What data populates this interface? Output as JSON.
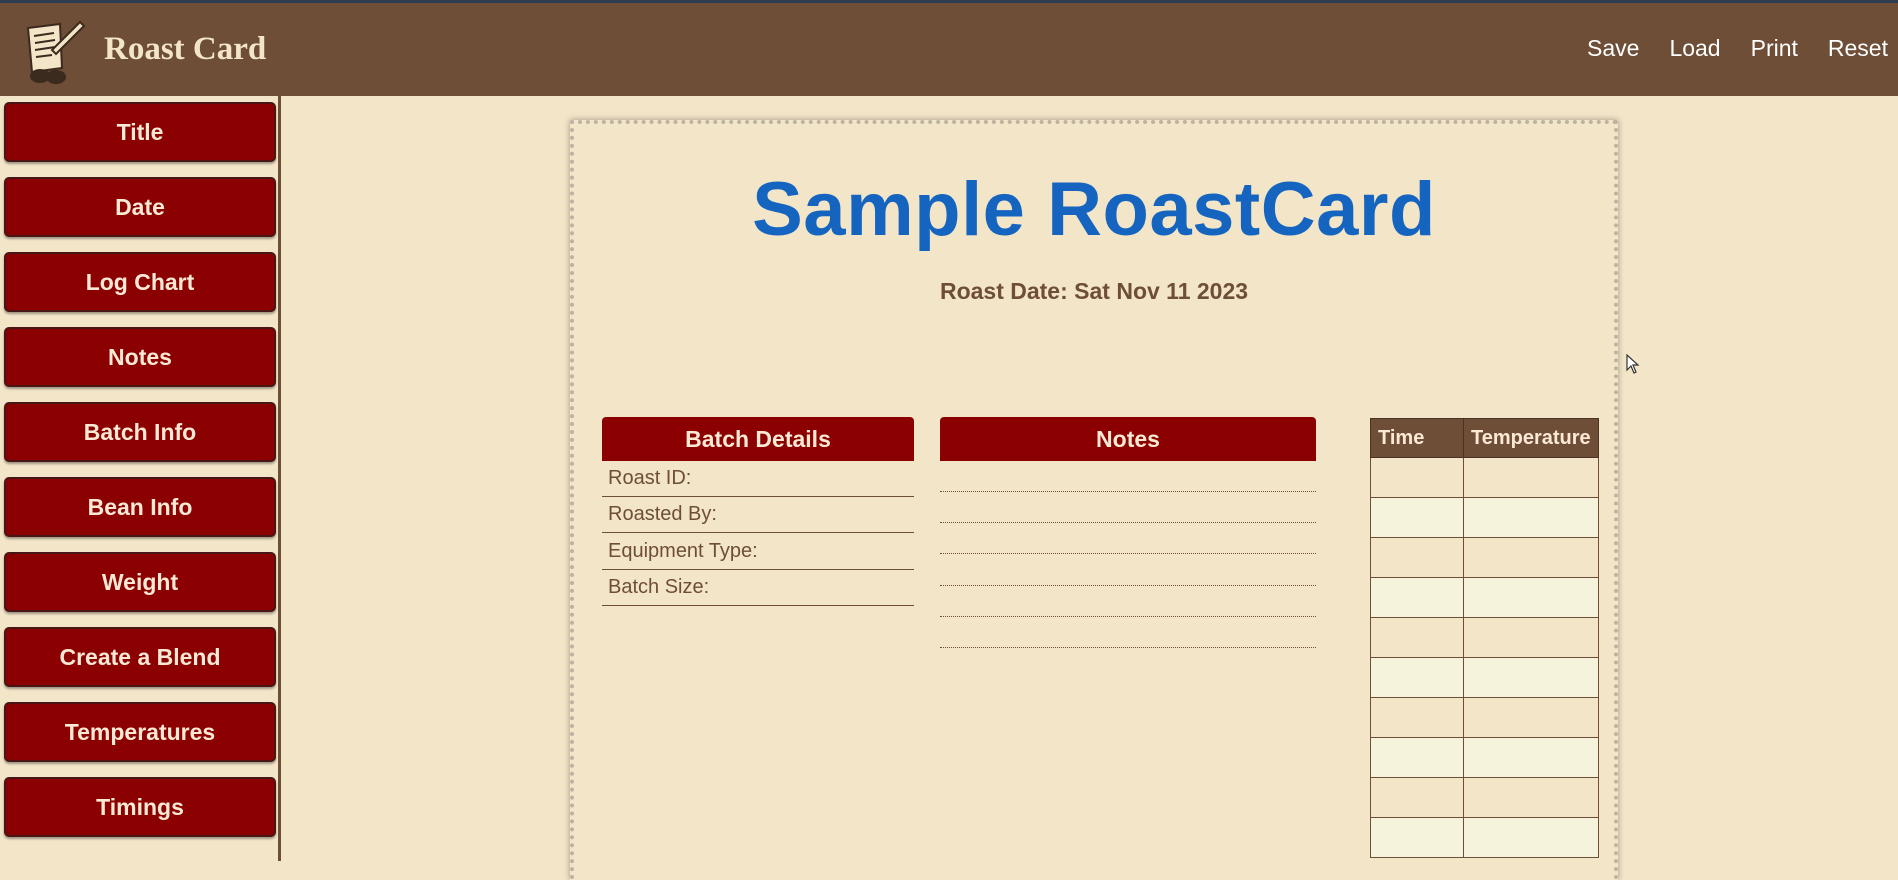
{
  "app": {
    "title": "Roast Card"
  },
  "nav": [
    "Save",
    "Load",
    "Print",
    "Reset"
  ],
  "sidebar": {
    "items": [
      "Title",
      "Date",
      "Log Chart",
      "Notes",
      "Batch Info",
      "Bean Info",
      "Weight",
      "Create a Blend",
      "Temperatures",
      "Timings"
    ]
  },
  "card": {
    "title": "Sample RoastCard",
    "date": "Roast Date: Sat Nov 11 2023",
    "batch": {
      "heading": "Batch Details",
      "fields": [
        "Roast ID:",
        "Roasted By:",
        "Equipment Type:",
        "Batch Size:"
      ]
    },
    "notes": {
      "heading": "Notes"
    },
    "temp_table": {
      "headers": [
        "Time",
        "Temperature"
      ]
    }
  },
  "colors": {
    "header_bg": "#6e4e37",
    "button_bg": "#8b0000",
    "page_bg": "#f3e5c8",
    "title_blue": "#1565c0"
  }
}
